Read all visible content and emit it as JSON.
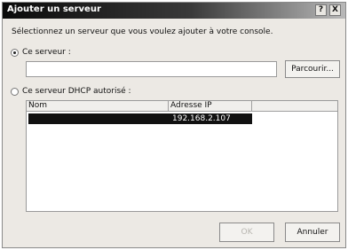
{
  "window": {
    "title": "Ajouter un serveur",
    "help_button": "?",
    "close_button": "X"
  },
  "instruction": "Sélectionnez un serveur que vous voulez ajouter à votre console.",
  "option_server": {
    "label": "Ce serveur :",
    "selected": true,
    "input_value": "",
    "browse_label": "Parcourir..."
  },
  "option_dhcp": {
    "label": "Ce serveur DHCP autorisé :",
    "selected": false
  },
  "dhcp_list": {
    "columns": [
      "Nom",
      "Adresse IP"
    ],
    "rows": [
      {
        "name": "",
        "ip": "192.168.2.107",
        "selected": true
      }
    ]
  },
  "buttons": {
    "ok": "OK",
    "cancel": "Annuler"
  }
}
